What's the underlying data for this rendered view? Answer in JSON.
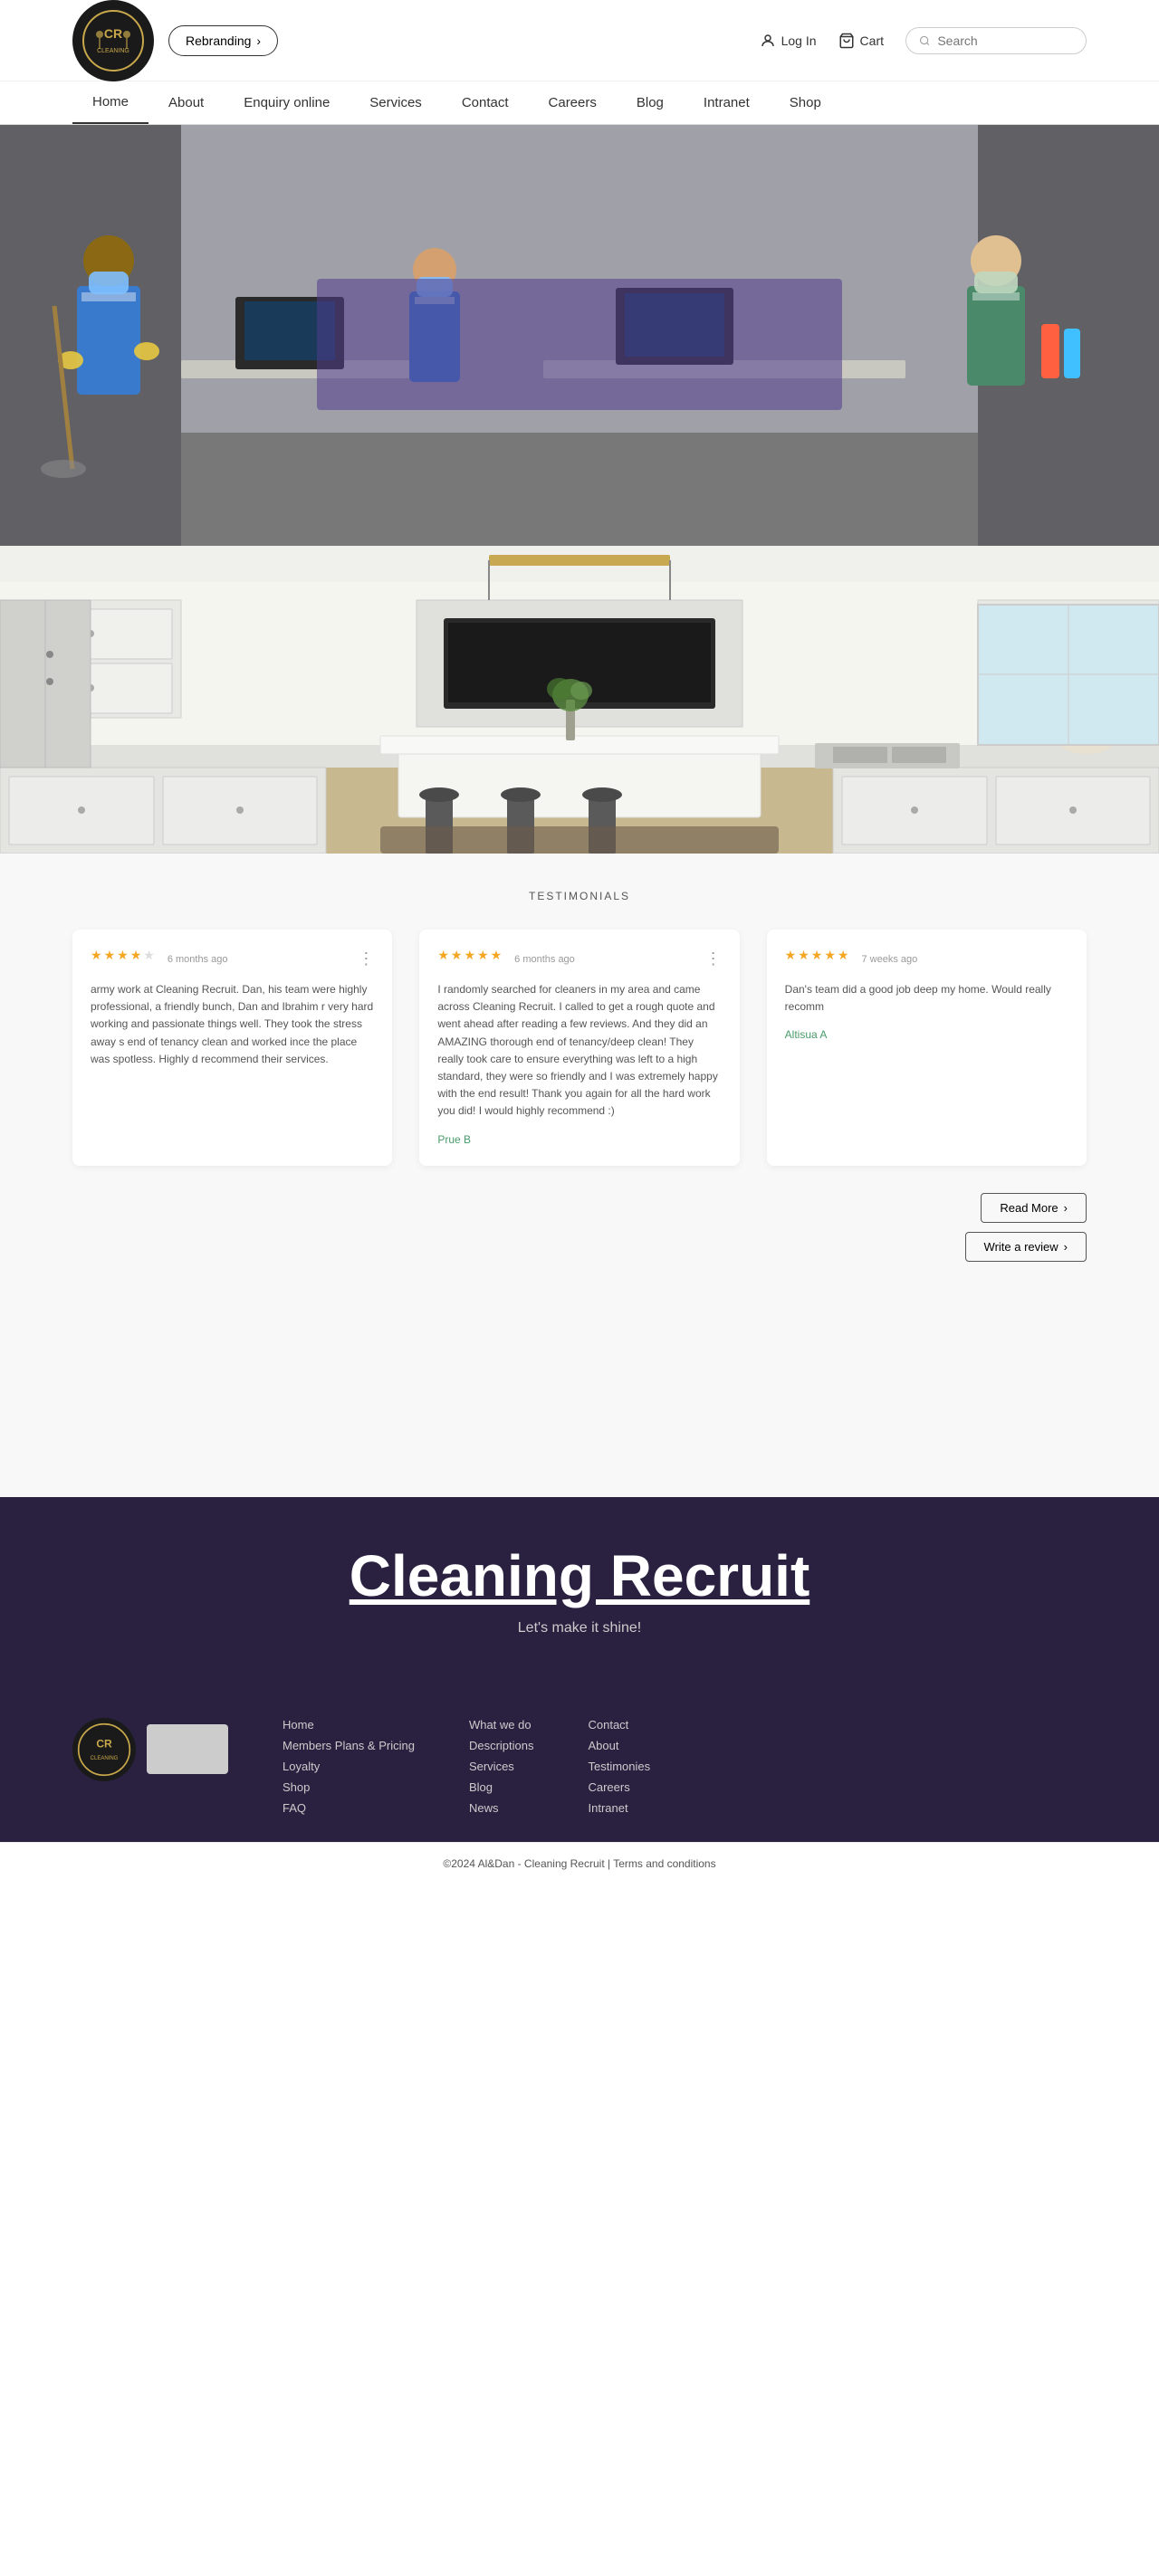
{
  "topbar": {
    "logo_alt": "Cleaning Recruit Logo",
    "rebranding_label": "Rebranding",
    "login_label": "Log In",
    "cart_label": "Cart",
    "search_placeholder": "Search"
  },
  "nav": {
    "items": [
      {
        "label": "Home",
        "active": true
      },
      {
        "label": "About",
        "active": false
      },
      {
        "label": "Enquiry online",
        "active": false
      },
      {
        "label": "Services",
        "active": false
      },
      {
        "label": "Contact",
        "active": false
      },
      {
        "label": "Careers",
        "active": false
      },
      {
        "label": "Blog",
        "active": false
      },
      {
        "label": "Intranet",
        "active": false
      },
      {
        "label": "Shop",
        "active": false
      }
    ]
  },
  "testimonials": {
    "section_label": "TESTIMONIALS",
    "read_more_label": "Read More",
    "write_review_label": "Write a review",
    "reviews": [
      {
        "stars": 4,
        "time_ago": "6 months ago",
        "text": "army work at Cleaning Recruit. Dan, his team were highly professional, a friendly bunch, Dan and Ibrahim r very hard working and passionate things well. They took the stress away s end of tenancy clean and worked ince the place was spotless. Highly d recommend their services.",
        "reviewer": ""
      },
      {
        "stars": 5,
        "time_ago": "6 months ago",
        "text": "I randomly searched for cleaners in my area and came across Cleaning Recruit. I called to get a rough quote and went ahead after reading a few reviews. And they did an AMAZING thorough end of tenancy/deep clean! They really took care to ensure everything was left to a high standard, they were so friendly and I was extremely happy with the end result! Thank you again for all the hard work you did! I would highly recommend :)",
        "reviewer": "Prue B"
      },
      {
        "stars": 5,
        "time_ago": "7 weeks ago",
        "text": "Dan's team did a good job deep my home. Would really recomm",
        "reviewer": "Altisua A"
      }
    ]
  },
  "footer": {
    "brand_title": "Cleaning Recruit",
    "brand_tagline": "Let's make it shine!",
    "col1": {
      "links": [
        "Home",
        "Members Plans & Pricing",
        "Loyalty",
        "Shop",
        "FAQ"
      ]
    },
    "col2": {
      "links": [
        "What we do",
        "Descriptions",
        "Services",
        "Blog",
        "News"
      ]
    },
    "col3": {
      "links": [
        "Contact",
        "About",
        "Testimonies",
        "Careers",
        "Intranet"
      ]
    },
    "copyright": "©2024 Al&Dan - Cleaning Recruit | Terms and conditions"
  }
}
